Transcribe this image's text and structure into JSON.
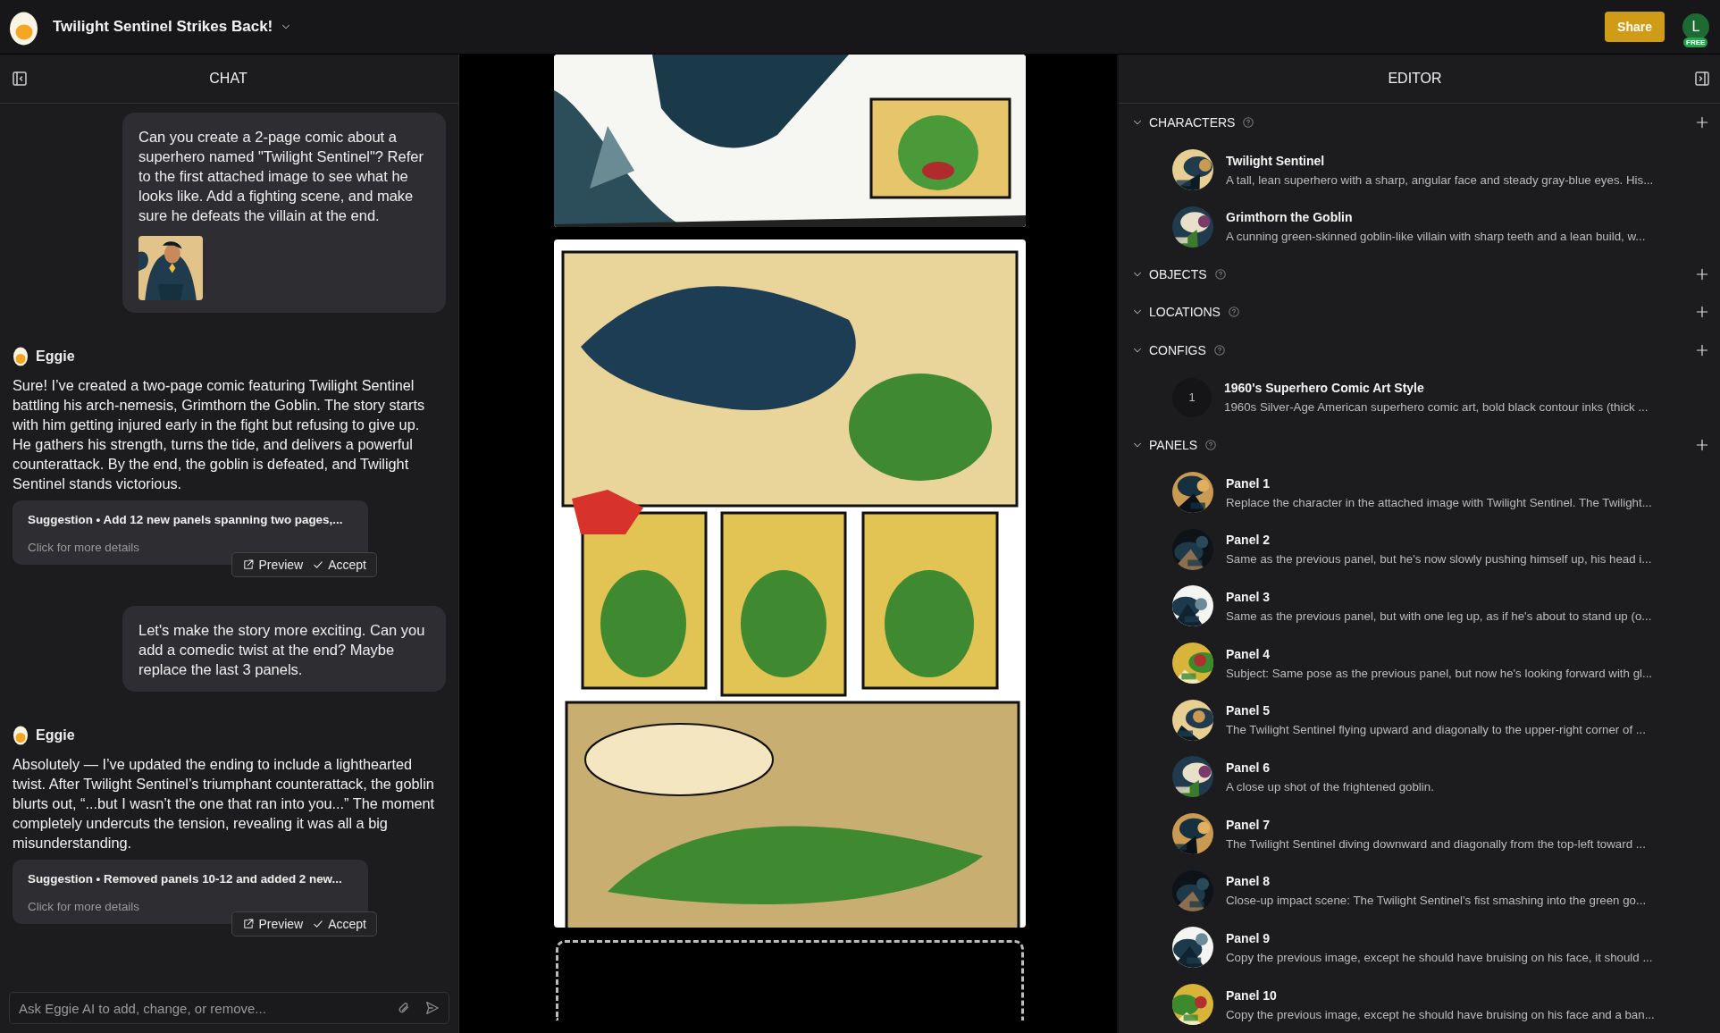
{
  "app": {
    "title": "Twilight Sentinel Strikes Back!",
    "share": "Share",
    "avatar": "L",
    "plan": "FREE"
  },
  "chat": {
    "title": "CHAT",
    "messages": [
      {
        "kind": "user",
        "text": "Can you create a 2-page comic about a superhero named \"Twilight Sentinel\"? Refer to the first attached image to see what he looks like. Add a fighting scene, and make sure he defeats the villain at the end.",
        "attachment": {
          "kind": "picture"
        }
      },
      {
        "kind": "assistant",
        "author": "Eggie",
        "text": "Sure! I’ve created a two-page comic featuring Twilight Sentinel battling his arch-nemesis, Grimthorn the Goblin. The story starts with him getting injured early in the fight but refusing to give up. He gathers his strength, turns the tide, and delivers a powerful counterattack. By the end, the goblin is defeated, and Twilight Sentinel stands victorious.",
        "suggestion": {
          "summary": "Suggestion • Add 12 new panels spanning two pages,...",
          "details": "Click for more details",
          "preview": "Preview",
          "accept": "Accept"
        }
      },
      {
        "kind": "user",
        "text": "Let's make the story more exciting. Can you add a comedic twist at the end? Maybe replace the last 3 panels."
      },
      {
        "kind": "assistant",
        "author": "Eggie",
        "text": "Absolutely — I’ve updated the ending to include a lighthearted twist. After Twilight Sentinel’s triumphant counterattack, the goblin blurts out, “...but I wasn’t the one that ran into you...” The moment completely undercuts the tension, revealing it was all a big misunderstanding.",
        "suggestion": {
          "summary": "Suggestion • Removed panels 10-12 and added 2 new...",
          "details": "Click for more details",
          "preview": "Preview",
          "accept": "Accept"
        }
      }
    ],
    "input": {
      "placeholder": "Ask Eggie AI to add, change, or remove..."
    }
  },
  "canvas": {
    "pages": [
      {
        "kind": "picture"
      },
      {
        "kind": "picture"
      },
      {
        "kind": "placeholder"
      }
    ]
  },
  "editor": {
    "title": "EDITOR",
    "sections": [
      {
        "title": "CHARACTERS",
        "expanded": true,
        "items": [
          {
            "kind": "picture",
            "name": "Twilight Sentinel",
            "description": "A tall, lean superhero with a sharp, angular face and steady gray-blue eyes. His..."
          },
          {
            "kind": "picture",
            "name": "Grimthorn the Goblin",
            "description": "A cunning green-skinned goblin-like villain with sharp teeth and a lean build, w..."
          }
        ]
      },
      {
        "title": "OBJECTS",
        "expanded": true
      },
      {
        "title": "LOCATIONS",
        "expanded": true
      },
      {
        "title": "CONFIGS",
        "expanded": true,
        "items": [
          {
            "kind": "number",
            "badge": "1",
            "name": "1960's Superhero Comic Art Style",
            "description": "1960s Silver-Age American superhero comic art, bold black contour inks (thick ..."
          }
        ]
      },
      {
        "title": "PANELS",
        "expanded": true,
        "items": [
          {
            "kind": "picture",
            "name": "Panel 1",
            "description": "Replace the character in the attached image with Twilight Sentinel. The Twilight..."
          },
          {
            "kind": "picture",
            "name": "Panel 2",
            "description": "Same as the previous panel, but he's now slowly pushing himself up, his head i..."
          },
          {
            "kind": "picture",
            "name": "Panel 3",
            "description": "Same as the previous panel, but with one leg up, as if he's about to stand up (o..."
          },
          {
            "kind": "picture",
            "name": "Panel 4",
            "description": "Subject: Same pose as the previous panel, but now he's looking forward with gl..."
          },
          {
            "kind": "picture",
            "name": "Panel 5",
            "description": "The Twilight Sentinel flying upward and diagonally to the upper-right corner of ..."
          },
          {
            "kind": "picture",
            "name": "Panel 6",
            "description": "A close up shot of the frightened goblin."
          },
          {
            "kind": "picture",
            "name": "Panel 7",
            "description": "The Twilight Sentinel diving downward and diagonally from the top-left toward ..."
          },
          {
            "kind": "picture",
            "name": "Panel 8",
            "description": "Close-up impact scene: The Twilight Sentinel’s fist smashing into the green go..."
          },
          {
            "kind": "picture",
            "name": "Panel 9",
            "description": "Copy the previous image, except he should have bruising on his face, it should ..."
          },
          {
            "kind": "picture",
            "name": "Panel 10",
            "description": "Copy the previous image, except he should have bruising on his face and a ban..."
          }
        ]
      }
    ]
  }
}
